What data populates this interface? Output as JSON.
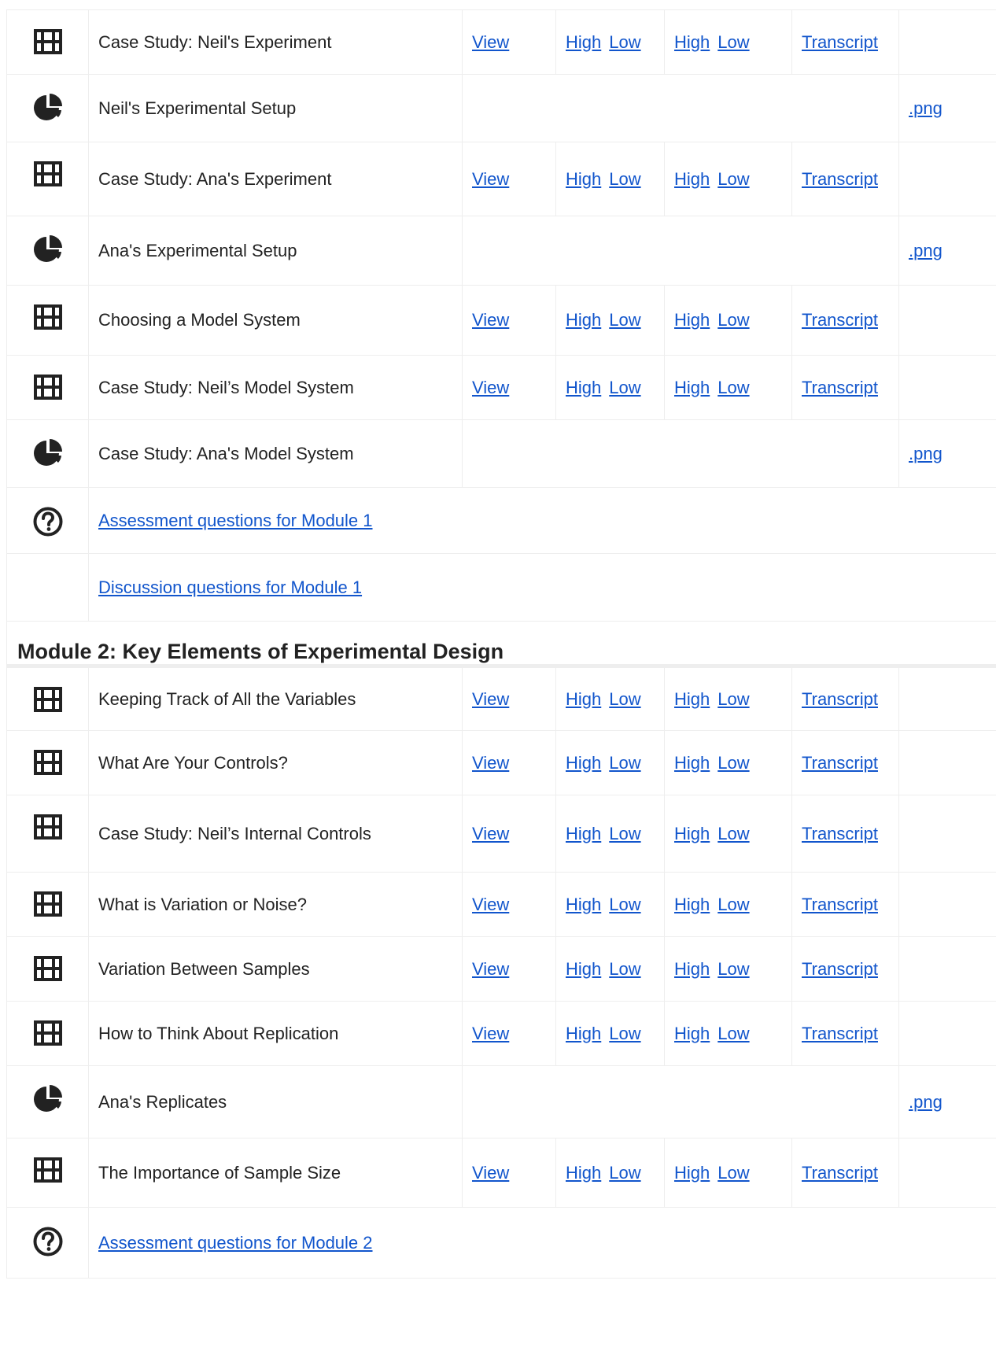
{
  "sections": [
    {
      "heading": "",
      "rows": [
        {
          "type": "video",
          "icon": "film-icon",
          "title": "Case Study: Neil's Experiment",
          "view": "View",
          "dl1_high": "High",
          "dl1_low": "Low",
          "dl2_high": "High",
          "dl2_low": "Low",
          "transcript": "Transcript"
        },
        {
          "type": "image",
          "icon": "pie-chart-icon",
          "title": "Neil's Experimental Setup",
          "png": ".png"
        },
        {
          "type": "video",
          "icon": "film-icon",
          "title": "Case Study: Ana's Experiment",
          "view": "View",
          "dl1_high": "High",
          "dl1_low": "Low",
          "dl2_high": "High",
          "dl2_low": "Low",
          "transcript": "Transcript"
        },
        {
          "type": "image",
          "icon": "pie-chart-icon",
          "title": "Ana's Experimental Setup",
          "png": ".png"
        },
        {
          "type": "video",
          "icon": "film-icon",
          "title": "Choosing a Model System",
          "view": "View",
          "dl1_high": "High",
          "dl1_low": "Low",
          "dl2_high": "High",
          "dl2_low": "Low",
          "transcript": "Transcript"
        },
        {
          "type": "video",
          "icon": "film-icon",
          "title": "Case Study: Neil’s Model System",
          "view": "View",
          "dl1_high": "High",
          "dl1_low": "Low",
          "dl2_high": "High",
          "dl2_low": "Low",
          "transcript": "Transcript"
        },
        {
          "type": "image",
          "icon": "pie-chart-icon",
          "title": "Case Study: Ana's Model System",
          "png": ".png"
        },
        {
          "type": "link",
          "icon": "question-circle-icon",
          "link": "Assessment questions for Module 1"
        },
        {
          "type": "link",
          "icon": "",
          "link": "Discussion questions for Module 1"
        }
      ]
    },
    {
      "heading": "Module 2: Key Elements of Experimental Design",
      "rows": [
        {
          "type": "video",
          "icon": "film-icon",
          "title": "Keeping Track of All the Variables",
          "view": "View",
          "dl1_high": "High",
          "dl1_low": "Low",
          "dl2_high": "High",
          "dl2_low": "Low",
          "transcript": "Transcript"
        },
        {
          "type": "video",
          "icon": "film-icon",
          "title": "What Are Your Controls?",
          "view": "View",
          "dl1_high": "High",
          "dl1_low": "Low",
          "dl2_high": "High",
          "dl2_low": "Low",
          "transcript": "Transcript"
        },
        {
          "type": "video",
          "icon": "film-icon",
          "title": "Case Study: Neil’s Internal Controls",
          "view": "View",
          "dl1_high": "High",
          "dl1_low": "Low",
          "dl2_high": "High",
          "dl2_low": "Low",
          "transcript": "Transcript"
        },
        {
          "type": "video",
          "icon": "film-icon",
          "title": "What is Variation or Noise?",
          "view": "View",
          "dl1_high": "High",
          "dl1_low": "Low",
          "dl2_high": "High",
          "dl2_low": "Low",
          "transcript": "Transcript"
        },
        {
          "type": "video",
          "icon": "film-icon",
          "title": "Variation Between Samples",
          "view": "View",
          "dl1_high": "High",
          "dl1_low": "Low",
          "dl2_high": "High",
          "dl2_low": "Low",
          "transcript": "Transcript"
        },
        {
          "type": "video",
          "icon": "film-icon",
          "title": "How to Think About Replication",
          "view": "View",
          "dl1_high": "High",
          "dl1_low": "Low",
          "dl2_high": "High",
          "dl2_low": "Low",
          "transcript": "Transcript"
        },
        {
          "type": "image",
          "icon": "pie-chart-icon",
          "title": "Ana's Replicates",
          "png": ".png"
        },
        {
          "type": "video",
          "icon": "film-icon",
          "title": "The Importance of Sample Size",
          "view": "View",
          "dl1_high": "High",
          "dl1_low": "Low",
          "dl2_high": "High",
          "dl2_low": "Low",
          "transcript": "Transcript"
        },
        {
          "type": "link",
          "icon": "question-circle-icon",
          "link": "Assessment questions for Module 2"
        }
      ]
    }
  ],
  "colors": {
    "link": "#1155cc",
    "text": "#222222",
    "border": "#eeeeee",
    "icon": "#222222"
  }
}
